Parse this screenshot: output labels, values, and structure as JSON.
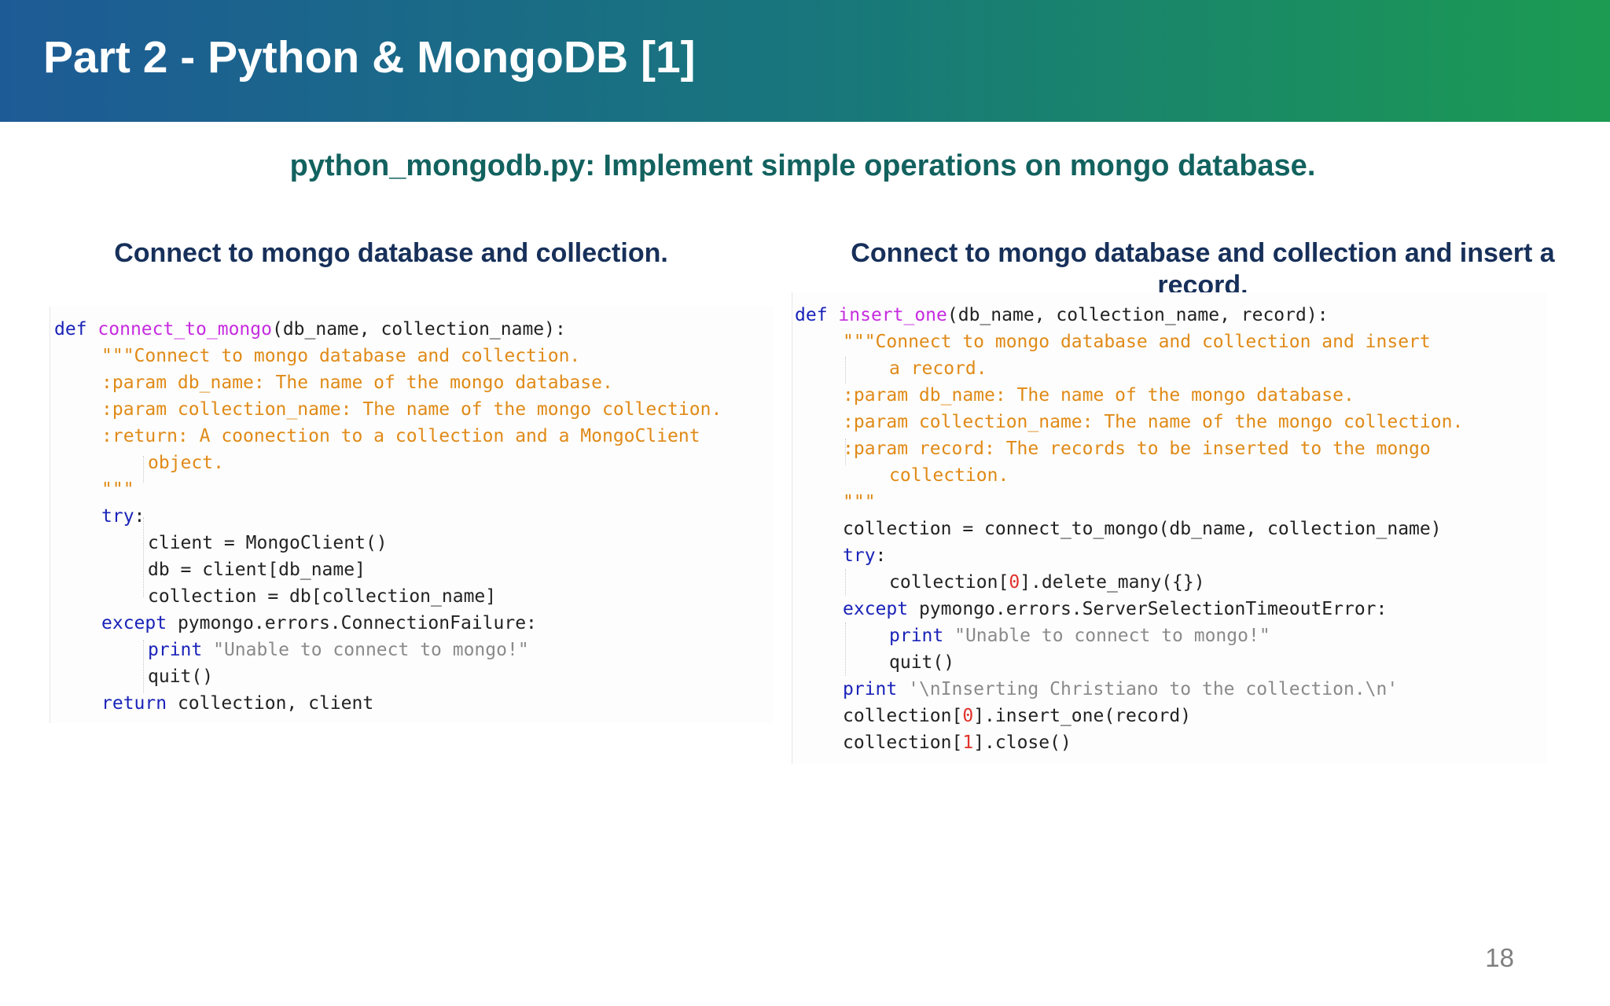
{
  "slide": {
    "title": "Part 2 - Python & MongoDB [1]",
    "subtitle": "python_mongodb.py: Implement simple operations on mongo database.",
    "page_number": "18"
  },
  "left": {
    "heading": "Connect to mongo database and collection.",
    "code": {
      "l1_kw": "def",
      "l1_fn": "connect_to_mongo",
      "l1_rest": "(db_name, collection_name):",
      "l2": "\"\"\"Connect to mongo database and collection.",
      "l3": ":param db_name: The name of the mongo database.",
      "l4": ":param collection_name: The name of the mongo collection.",
      "l5": ":return: A coonection to a collection and a MongoClient",
      "l6": "object.",
      "l7": "\"\"\"",
      "l8_kw": "try",
      "l8_rest": ":",
      "l9": "client = MongoClient()",
      "l10": "db = client[db_name]",
      "l11": "collection = db[collection_name]",
      "l12_kw": "except",
      "l12_rest": " pymongo.errors.ConnectionFailure:",
      "l13_kw": "print",
      "l13_str": " \"Unable to connect to mongo!\"",
      "l14": "quit()",
      "l15_kw": "return",
      "l15_rest": " collection, client"
    }
  },
  "right": {
    "heading": "Connect to mongo database and collection and insert a record.",
    "code": {
      "l1_kw": "def",
      "l1_fn": "insert_one",
      "l1_rest": "(db_name, collection_name, record):",
      "l2": "\"\"\"Connect to mongo database and collection and insert",
      "l3": "a record.",
      "l4": ":param db_name: The name of the mongo database.",
      "l5": ":param collection_name: The name of the mongo collection.",
      "l6": ":param record: The records to be inserted to the mongo",
      "l7": "collection.",
      "l8": "\"\"\"",
      "l9": "collection = connect_to_mongo(db_name, collection_name)",
      "l10_kw": "try",
      "l10_rest": ":",
      "l11_a": "collection[",
      "l11_num": "0",
      "l11_b": "].delete_many({})",
      "l12_kw": "except",
      "l12_rest": " pymongo.errors.ServerSelectionTimeoutError:",
      "l13_kw": "print",
      "l13_str": " \"Unable to connect to mongo!\"",
      "l14": "quit()",
      "l15_kw": "print",
      "l15_str": " '\\nInserting Christiano to the collection.\\n'",
      "l16_a": "collection[",
      "l16_num": "0",
      "l16_b": "].insert_one(record)",
      "l17_a": "collection[",
      "l17_num": "1",
      "l17_b": "].close()"
    }
  },
  "colors": {
    "header_start": "#1d5b96",
    "header_end": "#1c9b52",
    "subtitle": "#12625f",
    "heading": "#17305a",
    "keyword": "#1a23b8",
    "function_name": "#c62be0",
    "docstring": "#e08a17",
    "string": "#8a8a8a",
    "number": "#e0322b"
  }
}
